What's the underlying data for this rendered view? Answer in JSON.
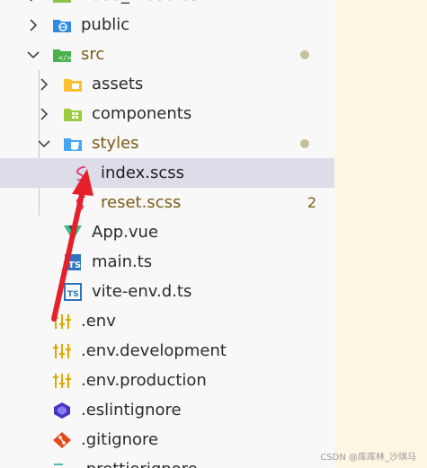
{
  "explorer": {
    "items": [
      {
        "label": "node_modules",
        "indent": 0,
        "kind": "folder-green",
        "chevron": "right"
      },
      {
        "label": "public",
        "indent": 0,
        "kind": "folder-public",
        "chevron": "right"
      },
      {
        "label": "src",
        "indent": 0,
        "kind": "folder-src",
        "chevron": "down",
        "modified": true
      },
      {
        "label": "assets",
        "indent": 1,
        "kind": "folder-assets",
        "chevron": "right"
      },
      {
        "label": "components",
        "indent": 1,
        "kind": "folder-components",
        "chevron": "right"
      },
      {
        "label": "styles",
        "indent": 1,
        "kind": "folder-styles",
        "chevron": "down",
        "modified": true
      },
      {
        "label": "index.scss",
        "indent": 2,
        "kind": "sass",
        "selected": true
      },
      {
        "label": "reset.scss",
        "indent": 2,
        "kind": "sass",
        "modified": true,
        "badge": "2"
      },
      {
        "label": "App.vue",
        "indent": 1,
        "kind": "vue"
      },
      {
        "label": "main.ts",
        "indent": 1,
        "kind": "ts"
      },
      {
        "label": "vite-env.d.ts",
        "indent": 1,
        "kind": "tsd"
      },
      {
        "label": ".env",
        "indent": 0,
        "kind": "env"
      },
      {
        "label": ".env.development",
        "indent": 0,
        "kind": "env"
      },
      {
        "label": ".env.production",
        "indent": 0,
        "kind": "env"
      },
      {
        "label": ".eslintignore",
        "indent": 0,
        "kind": "eslint"
      },
      {
        "label": ".gitignore",
        "indent": 0,
        "kind": "git"
      },
      {
        "label": ".prettierignore",
        "indent": 0,
        "kind": "prettier"
      }
    ]
  },
  "colors": {
    "accent_arrow": "#e5202b",
    "modified_dot": "#c9bf9a",
    "selected_bg": "#dcdde8"
  },
  "watermark": "CSDN @库库林_沙琪马"
}
